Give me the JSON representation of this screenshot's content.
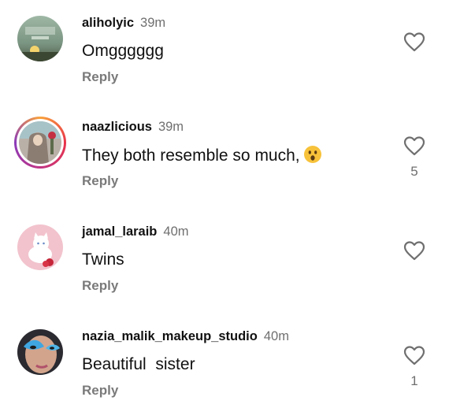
{
  "comments": [
    {
      "username": "aliholyic",
      "time": "39m",
      "text": "Omgggggg",
      "reply_label": "Reply",
      "likes": "",
      "avatar_icon": "landscape-avatar"
    },
    {
      "username": "naazlicious",
      "time": "39m",
      "text": "They both resemble so much,",
      "emoji": "surprised-face-emoji",
      "reply_label": "Reply",
      "likes": "5",
      "avatar_icon": "woman-hijab-avatar",
      "has_story_ring": true
    },
    {
      "username": "jamal_laraib",
      "time": "40m",
      "text": "Twins",
      "reply_label": "Reply",
      "likes": "",
      "avatar_icon": "white-cat-avatar"
    },
    {
      "username": "nazia_malik_makeup_studio",
      "time": "40m",
      "text": "Beautiful  sister",
      "reply_label": "Reply",
      "likes": "1",
      "avatar_icon": "makeup-eye-avatar"
    }
  ],
  "colors": {
    "text": "#111111",
    "secondary": "#6f6f6f",
    "story_ring": "#e8334a"
  }
}
